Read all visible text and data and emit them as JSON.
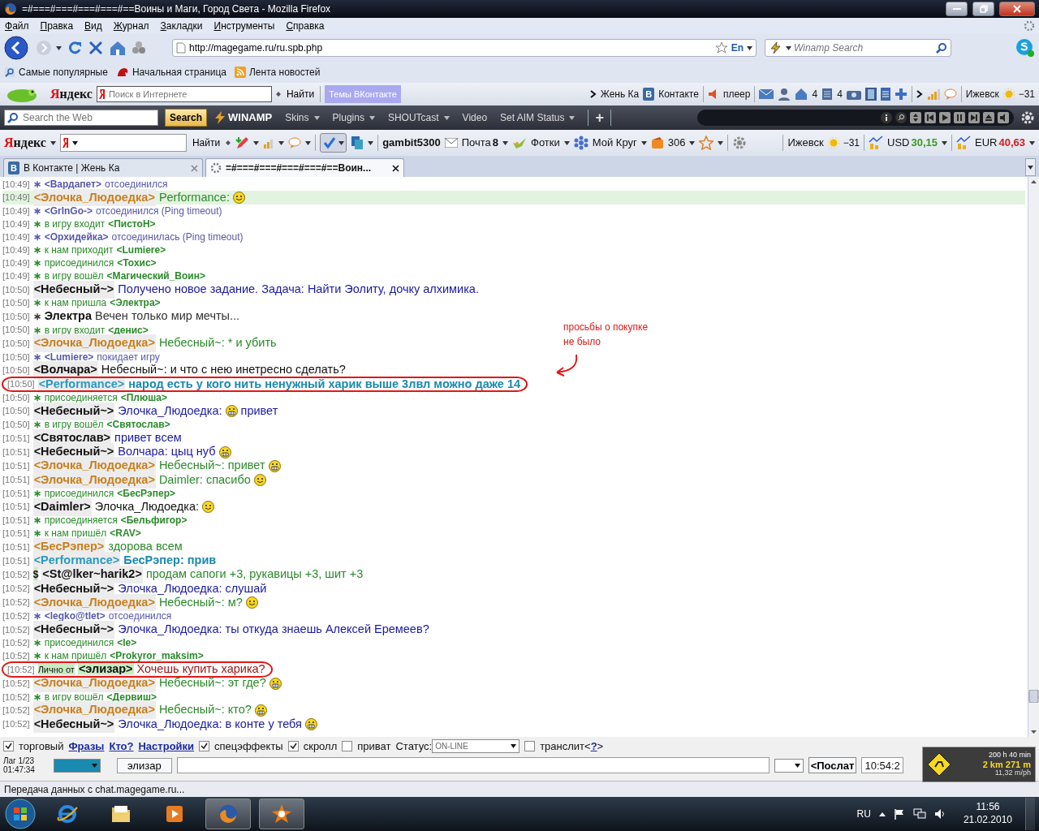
{
  "window": {
    "title": "=#===#===#===#===#==Воины и Маги, Город Света - Mozilla Firefox"
  },
  "menu": [
    "Файл",
    "Правка",
    "Вид",
    "Журнал",
    "Закладки",
    "Инструменты",
    "Справка"
  ],
  "address": {
    "value": "http://magegame.ru/ru.spb.php",
    "lang": "En"
  },
  "winamp_search": {
    "placeholder": "Winamp Search"
  },
  "bookmarks": [
    "Самые популярные",
    "Начальная страница",
    "Лента новостей"
  ],
  "yandex_bar": {
    "logo": "Яндекс",
    "placeholder": "Поиск в Интернете",
    "find": "Найти",
    "topics": "Темы ВКонтакте",
    "user": "Жень Ка",
    "vk_letter": "В",
    "vk_label": "Контакте",
    "player": "плеер",
    "home_count": "4",
    "docs_count": "4",
    "city": "Ижевск",
    "temp": "−31"
  },
  "winamp_bar": {
    "placeholder": "Search the Web",
    "search": "Search",
    "logo": "WINAMP",
    "menus": [
      {
        "label": "Skins",
        "dropdown": true
      },
      {
        "label": "Plugins",
        "dropdown": true
      },
      {
        "label": "SHOUTcast",
        "dropdown": true
      },
      {
        "label": "Video",
        "dropdown": false
      },
      {
        "label": "Set AIM Status",
        "dropdown": true
      }
    ],
    "add": "+"
  },
  "yandex_bar2": {
    "logo": "Яндекс",
    "find": "Найти",
    "user": "gambit5300",
    "mail": "Почта",
    "mail_count": "8",
    "photos": "Фотки",
    "circle": "Мой Круг",
    "wallet": "306",
    "city": "Ижевск",
    "temp": "−31",
    "usd_label": "USD",
    "usd": "30,15",
    "eur_label": "EUR",
    "eur": "40,63"
  },
  "tabs": [
    {
      "title": "В Контакте | Жень Ка",
      "icon_letter": "В",
      "selected": false
    },
    {
      "title": "=#===#===#===#===#==Воин...",
      "selected": true
    }
  ],
  "chat": {
    "lines": [
      {
        "kind": "system",
        "time": "[10:49]",
        "bullet": "∗",
        "color": "#5858a8",
        "nick": "<Вардапет>",
        "after": "отсоединился"
      },
      {
        "kind": "message",
        "time": "[10:49]",
        "nick": {
          "text": "<Элочка_Людоедка>",
          "color": "#c8801e"
        },
        "text": "Performance:",
        "color": "#2a8a2a",
        "smiley": {
          "kind": "smile"
        },
        "highlighted": true
      },
      {
        "kind": "system",
        "time": "[10:49]",
        "bullet": "∗",
        "color": "#5858a8",
        "nick": "<GrInGo->",
        "after": "отсоединился (Ping timeout)"
      },
      {
        "kind": "system",
        "time": "[10:49]",
        "bullet": "∗",
        "color": "#2a8a2a",
        "before": "в игру входит",
        "nick": "<ПистоН>"
      },
      {
        "kind": "system",
        "time": "[10:49]",
        "bullet": "∗",
        "color": "#5858a8",
        "nick": "<Орхидейка>",
        "after": "отсоединилась (Ping timeout)"
      },
      {
        "kind": "system",
        "time": "[10:49]",
        "bullet": "∗",
        "color": "#2a8a2a",
        "before": "к нам приходит",
        "nick": "<Lumiere>"
      },
      {
        "kind": "system",
        "time": "[10:49]",
        "bullet": "∗",
        "color": "#2a8a2a",
        "before": "присоединился",
        "nick": "<Тохис>"
      },
      {
        "kind": "system",
        "time": "[10:49]",
        "bullet": "∗",
        "color": "#2a8a2a",
        "before": "в игру вошёл",
        "nick": "<Магический_Воин>"
      },
      {
        "kind": "message",
        "time": "[10:50]",
        "nick": {
          "text": "<Небесный~>",
          "color": "#111111"
        },
        "text": "Получено новое задание. Задача: Найти Эолиту, дочку алхимика.",
        "color": "#1a1aa0"
      },
      {
        "kind": "system",
        "time": "[10:50]",
        "bullet": "∗",
        "color": "#2a8a2a",
        "before": "к нам пришла",
        "nick": "<Электра>"
      },
      {
        "kind": "action",
        "time": "[10:50]",
        "bullet": "∗",
        "nick": "Электра",
        "text": "Вечен только мир мечты...",
        "color": "#333333"
      },
      {
        "kind": "system",
        "time": "[10:50]",
        "bullet": "∗",
        "color": "#2a8a2a",
        "before": "в игру входит",
        "nick": "<денис>"
      },
      {
        "kind": "message",
        "time": "[10:50]",
        "nick": {
          "text": "<Элочка_Людоедка>",
          "color": "#c8801e"
        },
        "text": "Небесный~: * и убить",
        "color": "#2a8a2a"
      },
      {
        "kind": "system",
        "time": "[10:50]",
        "bullet": "∗",
        "color": "#5858a8",
        "nick": "<Lumiere>",
        "after": "покидает игру"
      },
      {
        "kind": "message",
        "time": "[10:50]",
        "nick": {
          "text": "<Волчара>",
          "color": "#111111"
        },
        "text": "Небесный~: и что с нею инетресно сделать?",
        "color": "#111111"
      },
      {
        "kind": "message",
        "time": "[10:50]",
        "nick": {
          "text": "<Performance>",
          "color": "#2a9ac0"
        },
        "text": "народ есть у кого нить ненужный харик выше 3лвл можно даже 14",
        "color": "#1a88b0",
        "bold": true,
        "circled": true
      },
      {
        "kind": "system",
        "time": "[10:50]",
        "bullet": "∗",
        "color": "#2a8a2a",
        "before": "присоединяется",
        "nick": "<Плюша>"
      },
      {
        "kind": "message",
        "time": "[10:50]",
        "nick": {
          "text": "<Небесный~>",
          "color": "#111111"
        },
        "text": "Элочка_Людоедка:",
        "color": "#1a1aa0",
        "smiley": {
          "kind": "grin"
        },
        "text_after": "привет"
      },
      {
        "kind": "system",
        "time": "[10:50]",
        "bullet": "∗",
        "color": "#2a8a2a",
        "before": "в игру вошёл",
        "nick": "<Святослав>"
      },
      {
        "kind": "message",
        "time": "[10:51]",
        "nick": {
          "text": "<Святослав>",
          "color": "#111111"
        },
        "text": "привет всем",
        "color": "#1a1aa0"
      },
      {
        "kind": "message",
        "time": "[10:51]",
        "nick": {
          "text": "<Небесный~>",
          "color": "#111111"
        },
        "text": "Волчара: цыц нуб",
        "color": "#1a1aa0",
        "smiley": {
          "kind": "grin"
        }
      },
      {
        "kind": "message",
        "time": "[10:51]",
        "nick": {
          "text": "<Элочка_Людоедка>",
          "color": "#c8801e"
        },
        "text": "Небесный~: привет",
        "color": "#2a8a2a",
        "smiley": {
          "kind": "grin"
        }
      },
      {
        "kind": "message",
        "time": "[10:51]",
        "nick": {
          "text": "<Элочка_Людоедка>",
          "color": "#c8801e"
        },
        "text": "Daimler: спасибо",
        "color": "#2a8a2a",
        "smiley": {
          "kind": "smile"
        }
      },
      {
        "kind": "system",
        "time": "[10:51]",
        "bullet": "∗",
        "color": "#2a8a2a",
        "before": "присоединился",
        "nick": "<БесРэпер>"
      },
      {
        "kind": "message",
        "time": "[10:51]",
        "nick": {
          "text": "<Daimler>",
          "color": "#111111"
        },
        "text": "Элочка_Людоедка:",
        "color": "#111111",
        "smiley": {
          "kind": "smile"
        }
      },
      {
        "kind": "system",
        "time": "[10:51]",
        "bullet": "∗",
        "color": "#2a8a2a",
        "before": "присоединяется",
        "nick": "<Бельфигор>"
      },
      {
        "kind": "system",
        "time": "[10:51]",
        "bullet": "∗",
        "color": "#2a8a2a",
        "before": "к нам пришёл",
        "nick": "<RAV>"
      },
      {
        "kind": "message",
        "time": "[10:51]",
        "nick": {
          "text": "<БесРэпер>",
          "color": "#c8801e"
        },
        "text": "здорова всем",
        "color": "#2a8a2a"
      },
      {
        "kind": "message",
        "time": "[10:51]",
        "nick": {
          "text": "<Performance>",
          "color": "#2a9ac0"
        },
        "text": "БесРэпер: прив",
        "color": "#1a88b0",
        "bold": true
      },
      {
        "kind": "message",
        "time": "[10:52]",
        "bullet": "$",
        "nick": {
          "text": "<St@lker~harik2>",
          "color": "#111111"
        },
        "text": "продам сапоги +3, рукавицы +3, шит +3",
        "color": "#2a8a2a"
      },
      {
        "kind": "message",
        "time": "[10:52]",
        "nick": {
          "text": "<Небесный~>",
          "color": "#111111"
        },
        "text": "Элочка_Людоедка: слушай",
        "color": "#1a1aa0"
      },
      {
        "kind": "message",
        "time": "[10:52]",
        "nick": {
          "text": "<Элочка_Людоедка>",
          "color": "#c8801e"
        },
        "text": "Небесный~: м?",
        "color": "#2a8a2a",
        "smiley": {
          "kind": "smile"
        }
      },
      {
        "kind": "system",
        "time": "[10:52]",
        "bullet": "∗",
        "color": "#5858a8",
        "nick": "<legko@tlet>",
        "after": "отсоединился"
      },
      {
        "kind": "message",
        "time": "[10:52]",
        "nick": {
          "text": "<Небесный~>",
          "color": "#111111"
        },
        "text": "Элочка_Людоедка: ты откуда знаешь Алексей Еремеев?",
        "color": "#1a1aa0"
      },
      {
        "kind": "system",
        "time": "[10:52]",
        "bullet": "∗",
        "color": "#2a8a2a",
        "before": "присоединился",
        "nick": "<le>"
      },
      {
        "kind": "system",
        "time": "[10:52]",
        "bullet": "∗",
        "color": "#2a8a2a",
        "before": "к нам пришёл",
        "nick": "<Prokyror_maksim>"
      },
      {
        "kind": "private",
        "time": "[10:52]",
        "label": "Лично от",
        "nick": {
          "text": "<элизар>",
          "color": "#111111"
        },
        "text": "Хочешь купить харика?",
        "color": "#a01818",
        "circled": true
      },
      {
        "kind": "message",
        "time": "[10:52]",
        "nick": {
          "text": "<Элочка_Людоедка>",
          "color": "#c8801e"
        },
        "text": "Небесный~: эт где?",
        "color": "#2a8a2a",
        "smiley": {
          "kind": "grin"
        }
      },
      {
        "kind": "system",
        "time": "[10:52]",
        "bullet": "∗",
        "color": "#2a8a2a",
        "before": "в игру вошёл",
        "nick": "<Дервиш>"
      },
      {
        "kind": "message",
        "time": "[10:52]",
        "nick": {
          "text": "<Элочка_Людоедка>",
          "color": "#c8801e"
        },
        "text": "Небесный~: кто?",
        "color": "#2a8a2a",
        "smiley": {
          "kind": "grin"
        }
      },
      {
        "kind": "message",
        "time": "[10:52]",
        "nick": {
          "text": "<Небесный~>",
          "color": "#111111"
        },
        "text": "Элочка_Людоедка: в конте у тебя",
        "color": "#1a1aa0",
        "smiley": {
          "kind": "grin"
        }
      }
    ]
  },
  "annotation": {
    "text": "просьбы о покупке\nне было"
  },
  "toolbar_items": [
    {
      "kind": "check",
      "label": "торговый",
      "checked": true
    },
    {
      "kind": "link",
      "label": "Фразы"
    },
    {
      "kind": "link",
      "label": "Кто?"
    },
    {
      "kind": "link",
      "label": "Настройки"
    },
    {
      "kind": "check",
      "label": "спецэффекты",
      "checked": true
    },
    {
      "kind": "check",
      "label": "скролл",
      "checked": true
    },
    {
      "kind": "check",
      "label": "приват",
      "checked": false
    },
    {
      "kind": "select",
      "label": "Статус:",
      "value": "ON-LINE"
    },
    {
      "kind": "check",
      "label": "транслит",
      "checked": false
    },
    {
      "kind": "help",
      "open": "<",
      "link": "?",
      "close": ">"
    }
  ],
  "input_row": {
    "lag": "Лаг 1/23",
    "clock": "01:47:34",
    "recipient": "элизар",
    "send": "<Послат",
    "time": "10:54:2"
  },
  "gadget": {
    "duration": "200 h 40 min",
    "distance": "2 km 271 m",
    "speed": "11,32 m/ph"
  },
  "status_bar": {
    "text": "Передача данных с chat.magegame.ru..."
  },
  "taskbar": {
    "apps": [
      {
        "kind": "ie",
        "running": false
      },
      {
        "kind": "explorer",
        "running": false
      },
      {
        "kind": "media",
        "running": false
      },
      {
        "kind": "firefox",
        "running": true
      },
      {
        "kind": "avast",
        "running": true
      }
    ],
    "lang": "RU",
    "time": "11:56",
    "date": "21.02.2010"
  }
}
